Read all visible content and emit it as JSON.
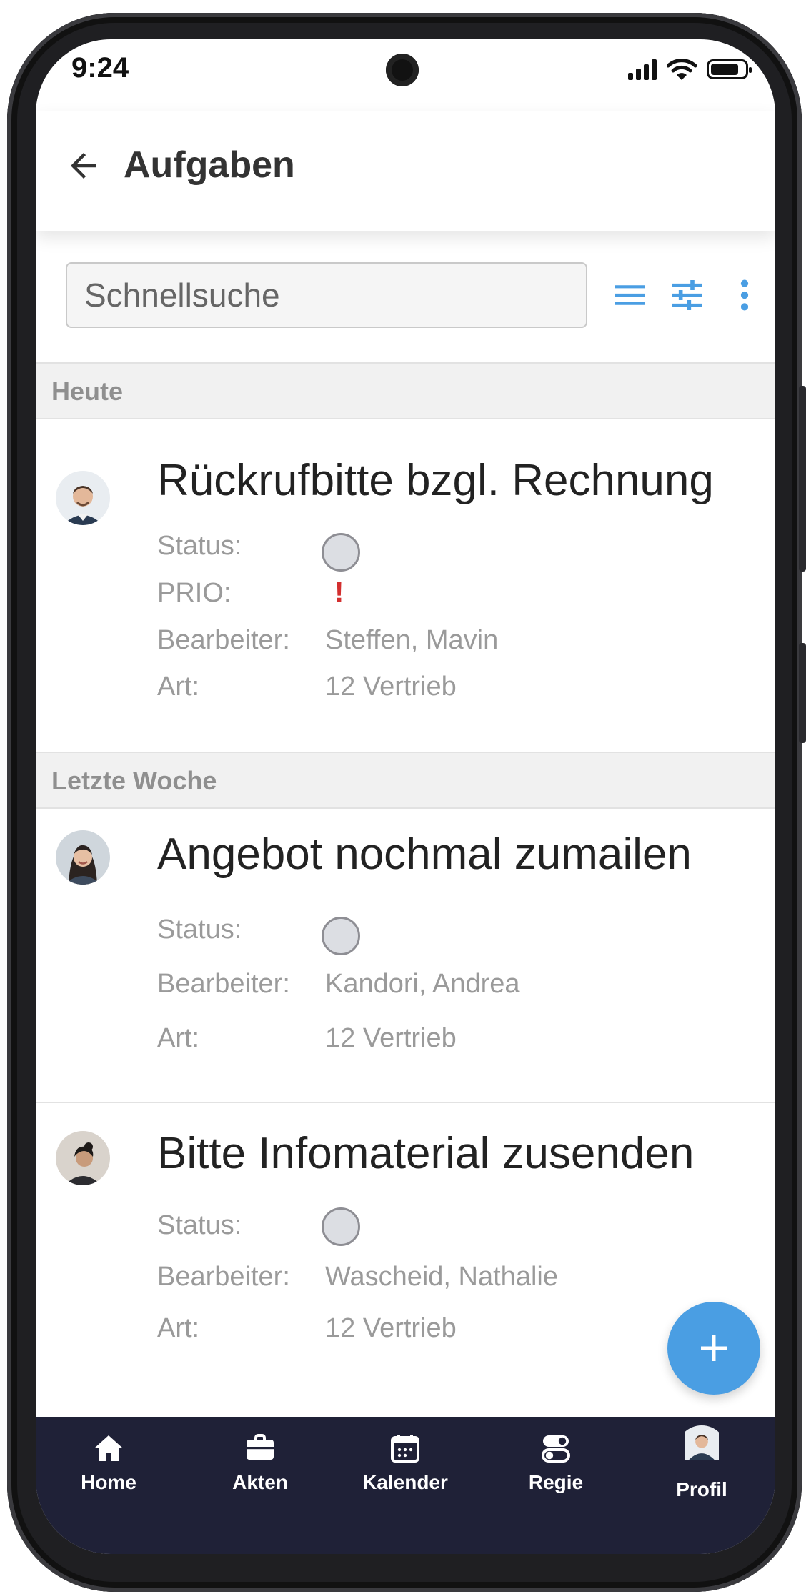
{
  "status_bar": {
    "time": "9:24"
  },
  "header": {
    "title": "Aufgaben"
  },
  "search": {
    "placeholder": "Schnellsuche"
  },
  "sections": [
    {
      "label": "Heute"
    },
    {
      "label": "Letzte Woche"
    }
  ],
  "labels": {
    "status": "Status:",
    "prio": "PRIO:",
    "bearbeiter": "Bearbeiter:",
    "art": "Art:"
  },
  "tasks": [
    {
      "title": "Rückrufbitte bzgl. Rechnung",
      "prio": "!",
      "bearbeiter": "Steffen, Mavin",
      "art": "12 Vertrieb"
    },
    {
      "title": "Angebot nochmal zumailen",
      "bearbeiter": "Kandori, Andrea",
      "art": "12 Vertrieb"
    },
    {
      "title": "Bitte Infomaterial zusenden",
      "bearbeiter": "Wascheid, Nathalie",
      "art": "12 Vertrieb"
    }
  ],
  "nav": [
    {
      "label": "Home",
      "icon": "home-icon"
    },
    {
      "label": "Akten",
      "icon": "briefcase-icon"
    },
    {
      "label": "Kalender",
      "icon": "calendar-icon"
    },
    {
      "label": "Regie",
      "icon": "toggle-icon"
    },
    {
      "label": "Profil",
      "icon": "avatar"
    }
  ],
  "colors": {
    "accent": "#4a9ee3",
    "nav_bg": "#1f2137",
    "prio": "#d32f2f"
  }
}
